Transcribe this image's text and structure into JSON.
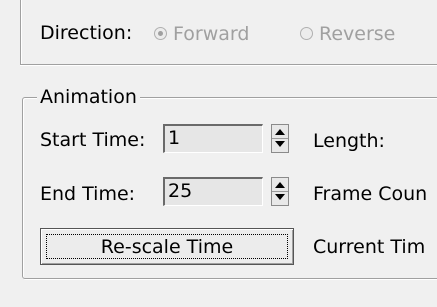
{
  "direction": {
    "label": "Direction:",
    "options": [
      {
        "label": "Forward",
        "selected": true
      },
      {
        "label": "Reverse",
        "selected": false
      }
    ]
  },
  "animation": {
    "legend": "Animation",
    "start_time": {
      "label": "Start Time:",
      "value": "1"
    },
    "end_time": {
      "label": "End Time:",
      "value": "25"
    },
    "length_label": "Length:",
    "frame_count_label": "Frame Coun",
    "current_time_label": "Current Tim",
    "rescale_button": "Re-scale Time"
  }
}
